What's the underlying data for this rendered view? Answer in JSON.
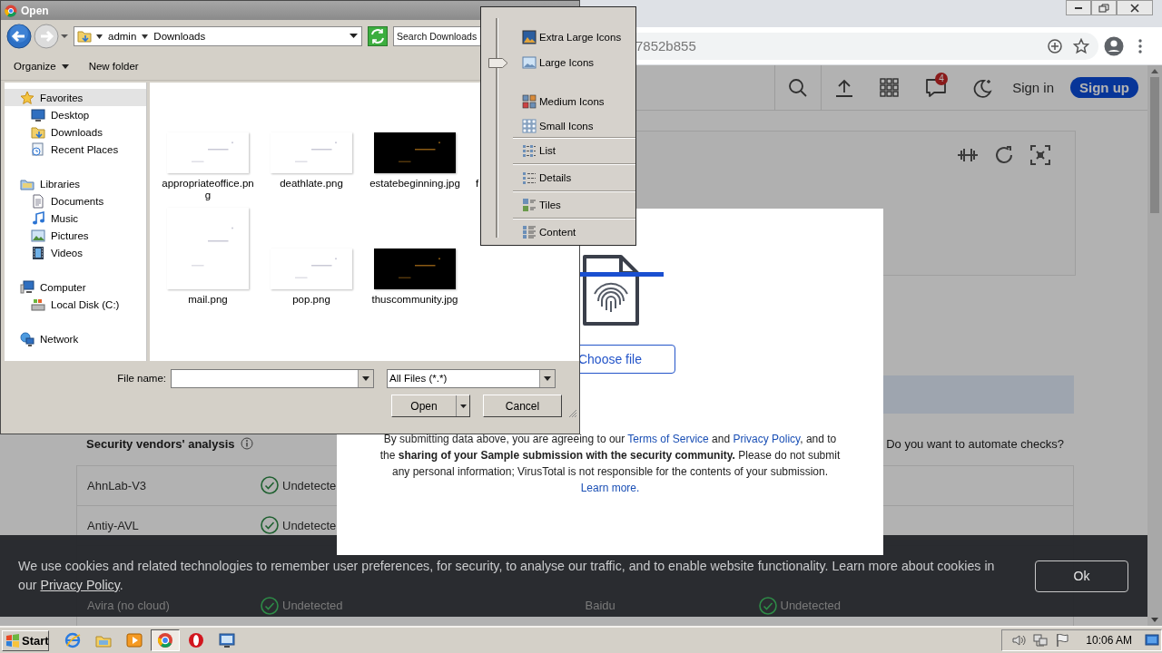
{
  "browser": {
    "url": "7852b855",
    "notifications": "4",
    "sign_in": "Sign in",
    "sign_up": "Sign up",
    "vendors": {
      "title": "Security vendors' analysis",
      "prompt": "Do you want to automate checks?",
      "rows": [
        {
          "vendor": "AhnLab-V3",
          "result": "Undetecte"
        },
        {
          "vendor": "Antiy-AVL",
          "result": "Undetecte"
        },
        {
          "vendor": "Avira (no cloud)",
          "result": "Undetected",
          "vendor_2": "Baidu",
          "result_2": "Undetected"
        }
      ]
    }
  },
  "upload_modal": {
    "button": "Choose file",
    "notice": [
      {
        "kind": "text",
        "text": "By submitting data above, you are agreeing to our "
      },
      {
        "kind": "link",
        "text": "Terms of Service"
      },
      {
        "kind": "text",
        "text": " and "
      },
      {
        "kind": "link",
        "text": "Privacy Policy"
      },
      {
        "kind": "text",
        "text": ", and to the "
      },
      {
        "kind": "bold",
        "text": "sharing of your Sample submission with the security community."
      },
      {
        "kind": "text",
        "text": " Please do not submit any personal information; VirusTotal is not responsible for the contents of your submission. "
      },
      {
        "kind": "link",
        "text": "Learn more."
      }
    ]
  },
  "cookie_banner": {
    "notice": [
      {
        "kind": "text",
        "text": "We use cookies and related technologies to remember user preferences, for security, to analyse our traffic, and to enable website functionality. Learn more about cookies in our "
      },
      {
        "kind": "link",
        "text": "Privacy Policy"
      },
      {
        "kind": "text",
        "text": "."
      }
    ],
    "button": "Ok"
  },
  "dialog": {
    "title": "Open",
    "path": [
      "admin",
      "Downloads"
    ],
    "search": {
      "placeholder": "Search Downloads"
    },
    "toolbar": [
      {
        "label": "Organize",
        "kind": "menu"
      },
      {
        "label": "New folder",
        "kind": "button"
      }
    ],
    "nav": [
      {
        "label": "Favorites",
        "selected": true,
        "children": [
          {
            "label": "Desktop",
            "selected": false
          },
          {
            "label": "Downloads",
            "selected": false
          },
          {
            "label": "Recent Places",
            "selected": false
          }
        ]
      },
      {
        "label": "Libraries",
        "selected": false,
        "children": [
          {
            "label": "Documents",
            "selected": false
          },
          {
            "label": "Music",
            "selected": false
          },
          {
            "label": "Pictures",
            "selected": false
          },
          {
            "label": "Videos",
            "selected": false
          }
        ]
      },
      {
        "label": "Computer",
        "selected": false,
        "children": [
          {
            "label": "Local Disk (C:)",
            "selected": false
          }
        ]
      },
      {
        "label": "Network",
        "selected": false
      }
    ],
    "files": [
      {
        "name": "appropriateoffice.png",
        "kind": "wide",
        "dark": false
      },
      {
        "name": "deathlate.png",
        "kind": "wide",
        "dark": false
      },
      {
        "name": "estatebeginning.jpg",
        "kind": "wide",
        "dark": true
      },
      {
        "name": "f",
        "kind": "partial"
      },
      {
        "name": "mail.png",
        "kind": "square",
        "dark": false
      },
      {
        "name": "pop.png",
        "kind": "wide",
        "dark": false
      },
      {
        "name": "thuscommunity.jpg",
        "kind": "wide",
        "dark": true
      }
    ],
    "file_name_label": "File name:",
    "file_type": "All Files (*.*)",
    "buttons": [
      {
        "label": "Open",
        "kind": "split"
      },
      {
        "label": "Cancel",
        "kind": "plain"
      }
    ]
  },
  "view_menu": {
    "items": [
      {
        "label": "Extra Large Icons",
        "kind": "size",
        "selected": false
      },
      {
        "label": "Large Icons",
        "kind": "size",
        "selected": true
      },
      {
        "label": "Medium Icons",
        "kind": "size",
        "selected": false
      },
      {
        "label": "Small Icons",
        "kind": "size",
        "selected": false
      },
      {
        "label": "List",
        "kind": "mode",
        "selected": false
      },
      {
        "label": "Details",
        "kind": "mode",
        "selected": false
      },
      {
        "label": "Tiles",
        "kind": "mode",
        "selected": false
      },
      {
        "label": "Content",
        "kind": "mode",
        "selected": false
      }
    ]
  },
  "taskbar": {
    "start": "Start",
    "clock": "10:06 AM",
    "apps": [
      {
        "kind": "globe",
        "selected": false
      },
      {
        "kind": "folder",
        "selected": false
      },
      {
        "kind": "player",
        "selected": false
      },
      {
        "kind": "browser",
        "selected": true
      },
      {
        "kind": "ring",
        "selected": false
      },
      {
        "kind": "display",
        "selected": false
      }
    ]
  }
}
